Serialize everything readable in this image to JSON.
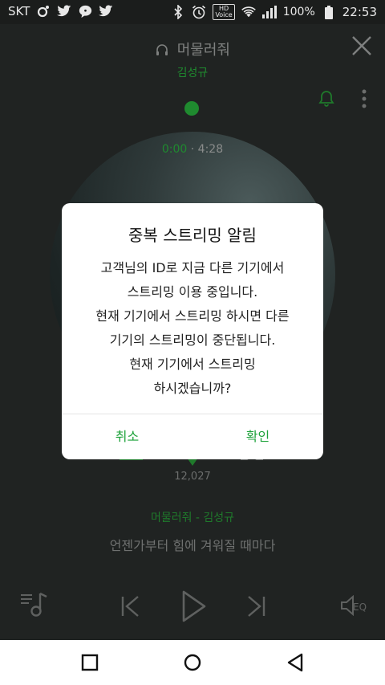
{
  "status_bar": {
    "carrier": "SKT",
    "battery": "100%",
    "time": "22:53",
    "hd_label": "HD\nVoice"
  },
  "player": {
    "song_title": "머물러줘",
    "artist": "김성규",
    "elapsed": "0:00",
    "separator": " · ",
    "duration": "4:28",
    "like_count": "12,027",
    "now_playing": "머물러줘 - 김성규",
    "lyric_line": "언젠가부터 힘에 겨워질 때마다",
    "eq_label": "EQ"
  },
  "dialog": {
    "title": "중복 스트리밍 알림",
    "lines": [
      "고객님의 ID로 지금 다른 기기에서",
      "스트리밍 이용 중입니다.",
      "현재 기기에서 스트리밍 하시면 다른",
      "기기의 스트리밍이 중단됩니다.",
      "현재 기기에서 스트리밍",
      "하시겠습니까?"
    ],
    "cancel_label": "취소",
    "confirm_label": "확인"
  },
  "colors": {
    "accent": "#1da23a",
    "dim_accent": "#1f8a2f",
    "overlay": "#1b1d1c"
  }
}
